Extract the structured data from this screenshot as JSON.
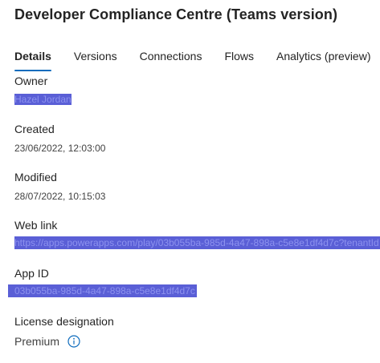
{
  "header": {
    "title": "Developer Compliance Centre (Teams version)"
  },
  "tabs": [
    {
      "label": "Details",
      "active": true
    },
    {
      "label": "Versions",
      "active": false
    },
    {
      "label": "Connections",
      "active": false
    },
    {
      "label": "Flows",
      "active": false
    },
    {
      "label": "Analytics (preview)",
      "active": false
    }
  ],
  "details": {
    "owner": {
      "label": "Owner",
      "value": "Hazel Jordan"
    },
    "created": {
      "label": "Created",
      "value": "23/06/2022, 12:03:00"
    },
    "modified": {
      "label": "Modified",
      "value": "28/07/2022, 10:15:03"
    },
    "web_link": {
      "label": "Web link",
      "value": "https://apps.powerapps.com/play/03b055ba-985d-4a47-898a-c5e8e1df4d7c?tenantId"
    },
    "app_id": {
      "label": "App ID",
      "value": "03b055ba-985d-4a47-898a-c5e8e1df4d7c"
    },
    "license": {
      "label": "License designation",
      "value": "Premium"
    }
  },
  "colors": {
    "accent": "#0f6cbd",
    "redaction": "#5a5fd6"
  },
  "icons": {
    "license_info": "info-icon"
  }
}
